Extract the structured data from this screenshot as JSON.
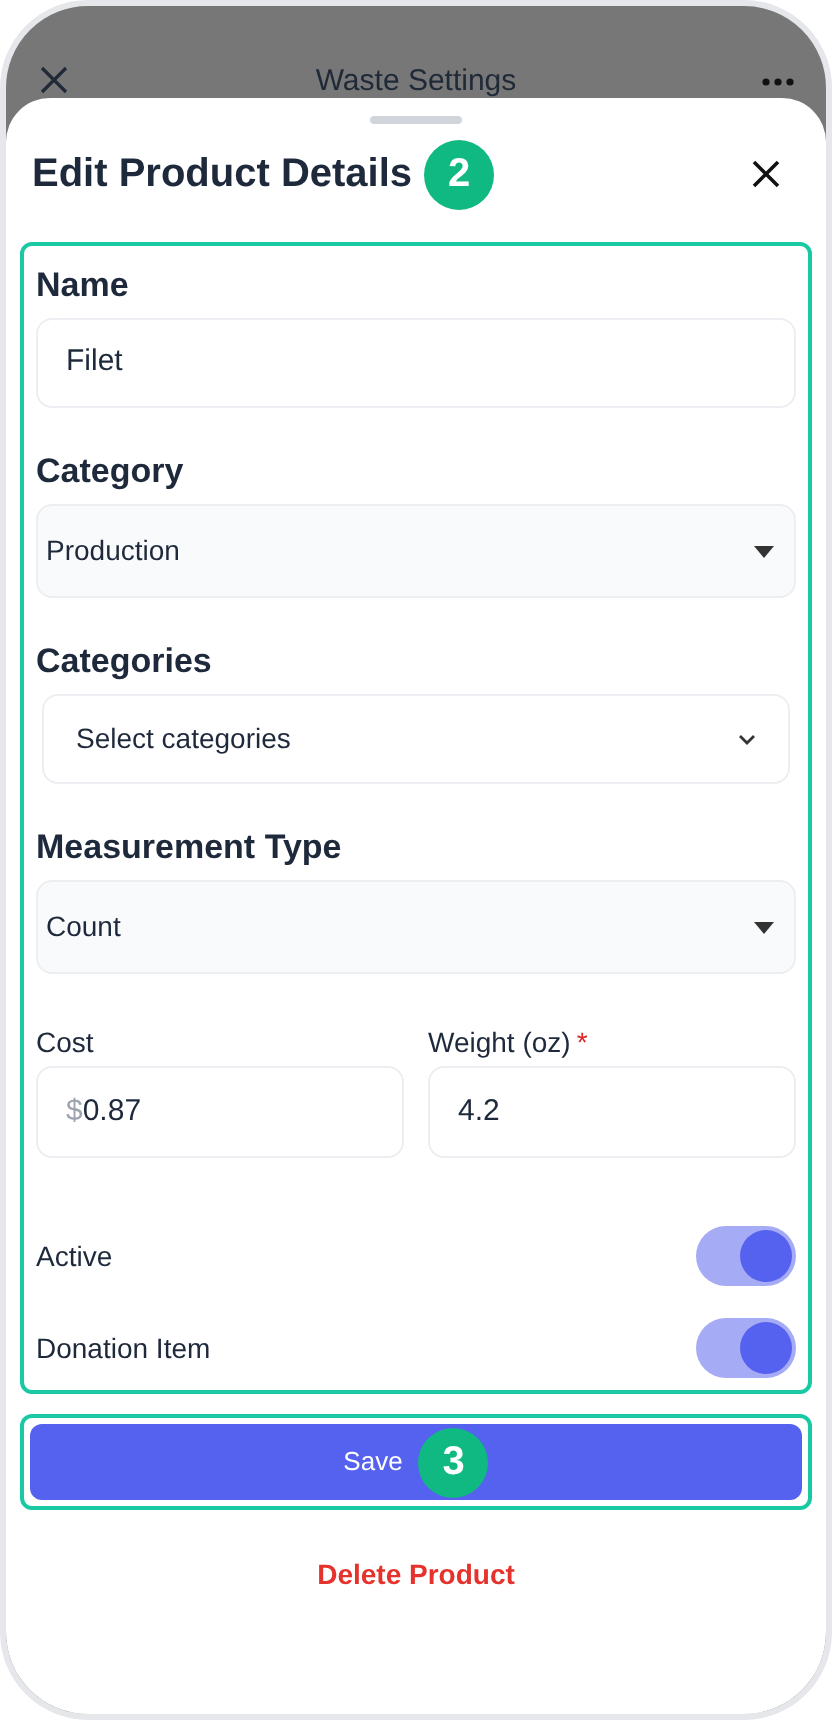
{
  "background_screen": {
    "title": "Waste Settings"
  },
  "sheet": {
    "title": "Edit Product Details",
    "title_badge": "2"
  },
  "fields": [
    {
      "kind": "text",
      "label": "Name",
      "value": "Filet"
    },
    {
      "kind": "select",
      "label": "Category",
      "value": "Production"
    },
    {
      "kind": "multiselect",
      "label": "Categories",
      "placeholder": "Select categories"
    },
    {
      "kind": "select",
      "label": "Measurement Type",
      "value": "Count"
    }
  ],
  "pair_fields": [
    {
      "label": "Cost",
      "prefix": "$",
      "value": "0.87"
    },
    {
      "label": "Weight (oz)",
      "value": "4.2",
      "required_mark": "*"
    }
  ],
  "toggles": [
    {
      "label": "Active",
      "on": true
    },
    {
      "label": "Donation Item",
      "on": true
    }
  ],
  "save_button": {
    "label": "Save",
    "badge": "3"
  },
  "delete_link": "Delete Product"
}
